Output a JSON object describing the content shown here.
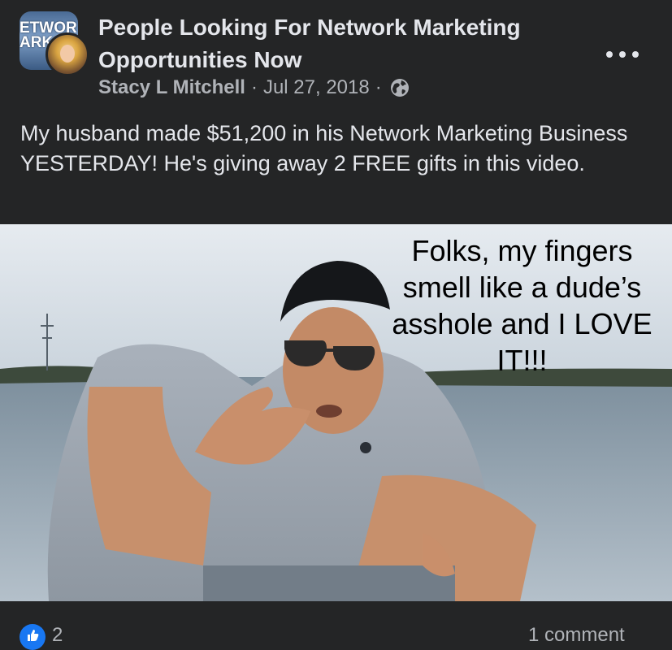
{
  "post": {
    "group_name": "People Looking For Network Marketing Opportunities Now",
    "group_logo_text": "ETWOR\nARK",
    "author": "Stacy L Mitchell",
    "date": "Jul 27, 2018",
    "separator": "·",
    "audience_icon": "globe-icon",
    "menu_icon": "more-options-icon",
    "text": "My husband made $51,200 in his Network Marketing Business YESTERDAY! He's giving away 2 FREE gifts in this video."
  },
  "media": {
    "caption": "Folks, my fingers smell like a dude’s asshole and I LOVE IT!!!"
  },
  "footer": {
    "reaction_icon": "like-icon",
    "reaction_count": "2",
    "comment_count": "1 comment"
  },
  "colors": {
    "background": "#242526",
    "text_primary": "#e4e6eb",
    "text_secondary": "#b0b3b8",
    "like_blue": "#1877f2"
  }
}
